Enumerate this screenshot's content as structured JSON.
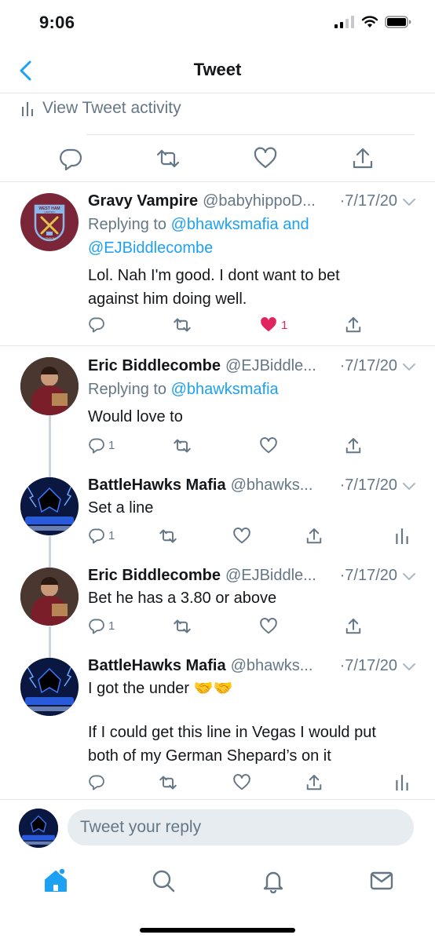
{
  "status_bar": {
    "time": "9:06"
  },
  "nav": {
    "title": "Tweet"
  },
  "activity": {
    "label": "View Tweet activity"
  },
  "tweets": [
    {
      "name": "Gravy Vampire",
      "handle": "@babyhippoD...",
      "date": "·7/17/20",
      "reply_prefix": "Replying to ",
      "reply_line1": "@bhawksmafia and",
      "reply_line2": "@EJBiddlecombe",
      "text_line1": "Lol. Nah I'm good. I dont want to bet",
      "text_line2": "against him doing well.",
      "like_count": "1",
      "avatar_text_top": "WEST HAM",
      "avatar_text_mid": "UNITED",
      "avatar_text_bottom": "LONDON"
    },
    {
      "name": "Eric Biddlecombe",
      "handle": "@EJBiddle...",
      "date": "·7/17/20",
      "reply_prefix": "Replying to ",
      "reply_line1": "@bhawksmafia",
      "text_line1": "Would love to",
      "reply_count": "1"
    },
    {
      "name": "BattleHawks Mafia",
      "handle": "@bhawks...",
      "date": "·7/17/20",
      "text_line1": "Set a line",
      "reply_count": "1"
    },
    {
      "name": "Eric Biddlecombe",
      "handle": "@EJBiddle...",
      "date": "·7/17/20",
      "text_line1": "Bet he has a 3.80 or above",
      "reply_count": "1"
    },
    {
      "name": "BattleHawks Mafia",
      "handle": "@bhawks...",
      "date": "·7/17/20",
      "text_line1": "I got the under 🤝🤝",
      "text_line2": "If I could get this line in Vegas I would put",
      "text_line3": "both of my German Shepard’s on it"
    }
  ],
  "reply_bar": {
    "placeholder": "Tweet your reply"
  },
  "tab_bar": {
    "items": [
      "home-icon",
      "search-icon",
      "notifications-icon",
      "messages-icon"
    ]
  },
  "colors": {
    "accent": "#1da1f2",
    "like": "#e0245e",
    "secondary_text": "#657786",
    "divider": "#e1e8ed"
  }
}
